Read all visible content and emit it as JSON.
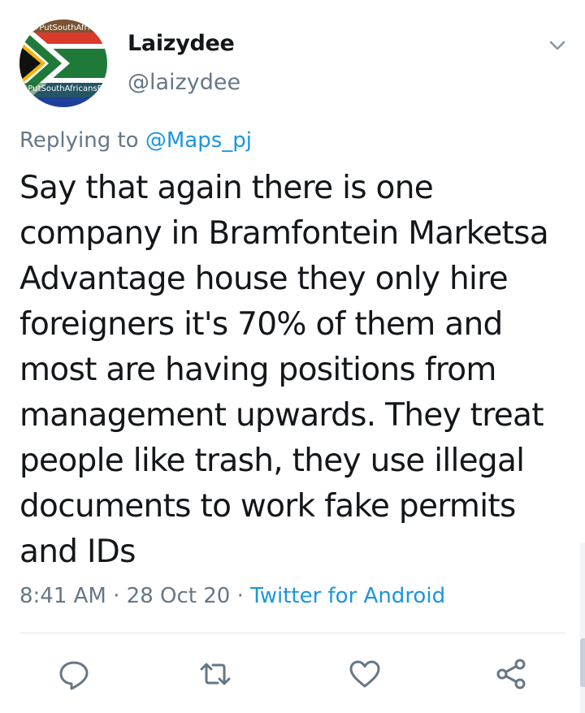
{
  "tweet": {
    "author": {
      "display_name": "Laizydee",
      "handle": "@laizydee",
      "avatar_text_top": "#PutSouthAfricansFi",
      "avatar_text_bottom": "#PutSouthAfricansFirs"
    },
    "reply_prefix": "Replying to ",
    "reply_mention": "@Maps_pj",
    "text": "Say that again there is one company in Bramfontein Marketsa Advantage house they only hire foreigners it's 70% of them and most are having positions from management upwards. They treat people like trash, they use illegal documents to work fake permits and IDs",
    "time": "8:41 AM",
    "date": "28 Oct 20",
    "separator": " · ",
    "source": "Twitter for Android"
  },
  "actions": {
    "reply_icon": "reply-icon",
    "retweet_icon": "retweet-icon",
    "like_icon": "like-icon",
    "share_icon": "share-icon"
  },
  "colors": {
    "text": "#14171a",
    "secondary": "#657786",
    "link": "#1b95e0",
    "divider": "#e1e8ed"
  }
}
